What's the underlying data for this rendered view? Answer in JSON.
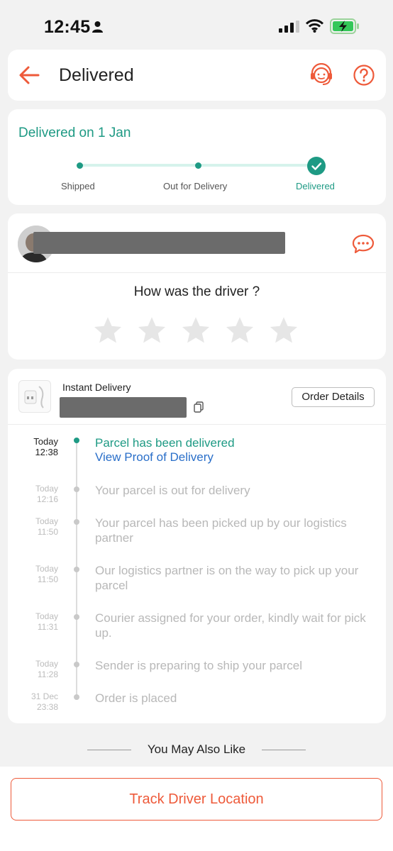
{
  "status_bar": {
    "time": "12:45"
  },
  "header": {
    "title": "Delivered"
  },
  "delivery_status": {
    "title": "Delivered on 1 Jan",
    "steps": [
      {
        "label": "Shipped",
        "state": "done"
      },
      {
        "label": "Out for Delivery",
        "state": "done"
      },
      {
        "label": "Delivered",
        "state": "current"
      }
    ]
  },
  "driver": {
    "rating_question": "How was the driver ?",
    "stars_total": 5,
    "stars_selected": 0
  },
  "shipment": {
    "type_label": "Instant Delivery",
    "order_details_label": "Order Details",
    "events": [
      {
        "date": "Today",
        "time": "12:38",
        "text": "Parcel has been delivered",
        "link": "View Proof of Delivery",
        "active": true
      },
      {
        "date": "Today",
        "time": "12:16",
        "text": "Your parcel is out for delivery",
        "active": false
      },
      {
        "date": "Today",
        "time": "11:50",
        "text": "Your parcel has been picked up by our logistics partner",
        "active": false
      },
      {
        "date": "Today",
        "time": "11:50",
        "text": "Our logistics partner is on the way to pick up your parcel",
        "active": false
      },
      {
        "date": "Today",
        "time": "11:31",
        "text": "Courier assigned for your order, kindly wait for pick up.",
        "active": false
      },
      {
        "date": "Today",
        "time": "11:28",
        "text": "Sender is preparing to ship your parcel",
        "active": false
      },
      {
        "date": "31 Dec",
        "time": "23:38",
        "text": "Order is placed",
        "active": false
      }
    ]
  },
  "recommendations": {
    "title": "You May Also Like"
  },
  "footer": {
    "track_button": "Track Driver Location"
  },
  "colors": {
    "accent_orange": "#ee5a3a",
    "success_green": "#1e9a84",
    "link_blue": "#2a6fc9"
  },
  "icons": [
    "person-icon",
    "signal-icon",
    "wifi-icon",
    "battery-charging-icon",
    "back-arrow-icon",
    "support-agent-icon",
    "help-icon",
    "chat-bubbles-icon",
    "star-icon",
    "check-icon",
    "copy-icon"
  ]
}
